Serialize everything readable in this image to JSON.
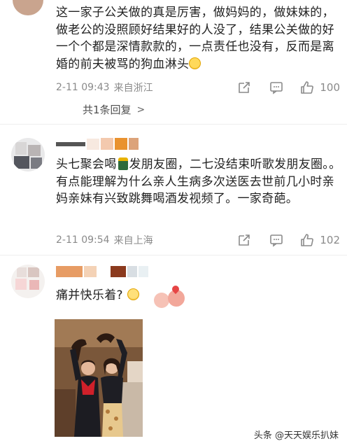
{
  "comments": [
    {
      "text": "这一家子公关做的真是厉害，做妈妈的，做妹妹的，做老公的没照顾好结果好的人没了，结果公关做的好一个个都是深情款款的，一点责任也没有，反而是离婚的前夫被骂的狗血淋头",
      "date": "2-11 09:43",
      "location": "来自浙江",
      "likes": "100",
      "reply_summary": "共1条回复",
      "emoji": "laugh-cry-emoji"
    },
    {
      "text_a": "头七聚会喝",
      "text_b": "发朋友圈，二七没结束听歌发朋友圈。。有点能理解为什么亲人生病多次送医去世前几小时亲妈亲妹有兴致跳舞喝酒发视频了。一家奇葩。",
      "date": "2-11 09:54",
      "location": "来自上海",
      "likes": "102",
      "emoji": "bottle-emoji"
    },
    {
      "text": "痛并快乐着?",
      "emoji": "smirk-emoji",
      "has_photo": true
    }
  ],
  "watermark": "头条 @天天娱乐扒妹",
  "colors": {
    "text": "#222222",
    "meta": "#8a8a8a",
    "divider": "#eeeeee"
  },
  "icons": {
    "share": "share-icon",
    "comment": "comment-icon",
    "like": "thumb-up-icon"
  }
}
